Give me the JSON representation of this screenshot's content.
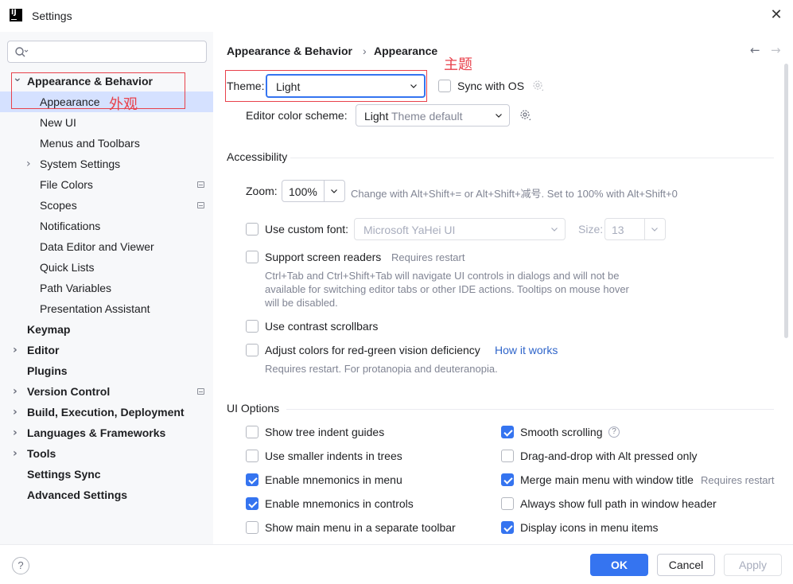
{
  "window": {
    "title": "Settings",
    "logo_text": "IJ"
  },
  "sidebar": {
    "search_placeholder": "",
    "items": [
      {
        "label": "Appearance & Behavior",
        "bold": true,
        "expanded": true,
        "indent": 0
      },
      {
        "label": "Appearance",
        "indent": 1,
        "selected": true
      },
      {
        "label": "New UI",
        "indent": 1
      },
      {
        "label": "Menus and Toolbars",
        "indent": 1
      },
      {
        "label": "System Settings",
        "indent": 1,
        "collapsed": true
      },
      {
        "label": "File Colors",
        "indent": 1,
        "project": true
      },
      {
        "label": "Scopes",
        "indent": 1,
        "project": true
      },
      {
        "label": "Notifications",
        "indent": 1
      },
      {
        "label": "Data Editor and Viewer",
        "indent": 1
      },
      {
        "label": "Quick Lists",
        "indent": 1
      },
      {
        "label": "Path Variables",
        "indent": 1
      },
      {
        "label": "Presentation Assistant",
        "indent": 1
      },
      {
        "label": "Keymap",
        "bold": true,
        "indent": 0
      },
      {
        "label": "Editor",
        "bold": true,
        "collapsed": true,
        "indent": 0
      },
      {
        "label": "Plugins",
        "bold": true,
        "indent": 0
      },
      {
        "label": "Version Control",
        "bold": true,
        "collapsed": true,
        "indent": 0,
        "project": true
      },
      {
        "label": "Build, Execution, Deployment",
        "bold": true,
        "collapsed": true,
        "indent": 0
      },
      {
        "label": "Languages & Frameworks",
        "bold": true,
        "collapsed": true,
        "indent": 0
      },
      {
        "label": "Tools",
        "bold": true,
        "collapsed": true,
        "indent": 0
      },
      {
        "label": "Settings Sync",
        "bold": true,
        "indent": 0
      },
      {
        "label": "Advanced Settings",
        "bold": true,
        "indent": 0
      }
    ],
    "annotation": "外观"
  },
  "breadcrumb": {
    "parent": "Appearance & Behavior",
    "separator": "›",
    "current": "Appearance"
  },
  "nav": {
    "back": "←",
    "forward": "→"
  },
  "theme": {
    "label": "Theme:",
    "value": "Light",
    "sync_label": "Sync with OS",
    "sync_checked": false,
    "annotation": "主题"
  },
  "color_scheme": {
    "label": "Editor color scheme:",
    "value_main": "Light",
    "value_sub": " Theme default"
  },
  "accessibility": {
    "title": "Accessibility",
    "zoom_label": "Zoom:",
    "zoom_value": "100%",
    "zoom_hint": "Change with Alt+Shift+= or Alt+Shift+减号. Set to 100% with Alt+Shift+0",
    "custom_font_label": "Use custom font:",
    "custom_font_value": "Microsoft YaHei UI",
    "size_label": "Size:",
    "size_value": "13",
    "screen_readers_label": "Support screen readers",
    "screen_readers_hint": "Requires restart",
    "screen_readers_desc": [
      "Ctrl+Tab and Ctrl+Shift+Tab will navigate UI controls in dialogs and will not be",
      "available for switching editor tabs or other IDE actions. Tooltips on mouse hover",
      "will be disabled."
    ],
    "contrast_label": "Use contrast scrollbars",
    "redgreen_label": "Adjust colors for red-green vision deficiency",
    "redgreen_link": "How it works",
    "redgreen_hint": "Requires restart. For protanopia and deuteranopia."
  },
  "ui_options": {
    "title": "UI Options",
    "left": [
      {
        "label": "Show tree indent guides",
        "checked": false
      },
      {
        "label": "Use smaller indents in trees",
        "checked": false
      },
      {
        "label": "Enable mnemonics in menu",
        "checked": true
      },
      {
        "label": "Enable mnemonics in controls",
        "checked": true
      },
      {
        "label": "Show main menu in a separate toolbar",
        "checked": false
      }
    ],
    "right": [
      {
        "label": "Smooth scrolling",
        "checked": true,
        "help": "?"
      },
      {
        "label": "Drag-and-drop with Alt pressed only",
        "checked": false
      },
      {
        "label": "Merge main menu with window title",
        "checked": true,
        "hint": "Requires restart"
      },
      {
        "label": "Always show full path in window header",
        "checked": false
      },
      {
        "label": "Display icons in menu items",
        "checked": true
      }
    ]
  },
  "footer": {
    "help": "?",
    "ok": "OK",
    "cancel": "Cancel",
    "apply": "Apply"
  },
  "colors": {
    "accent": "#3574f0",
    "selection": "#d5e1ff",
    "annotation": "#e8414b"
  }
}
